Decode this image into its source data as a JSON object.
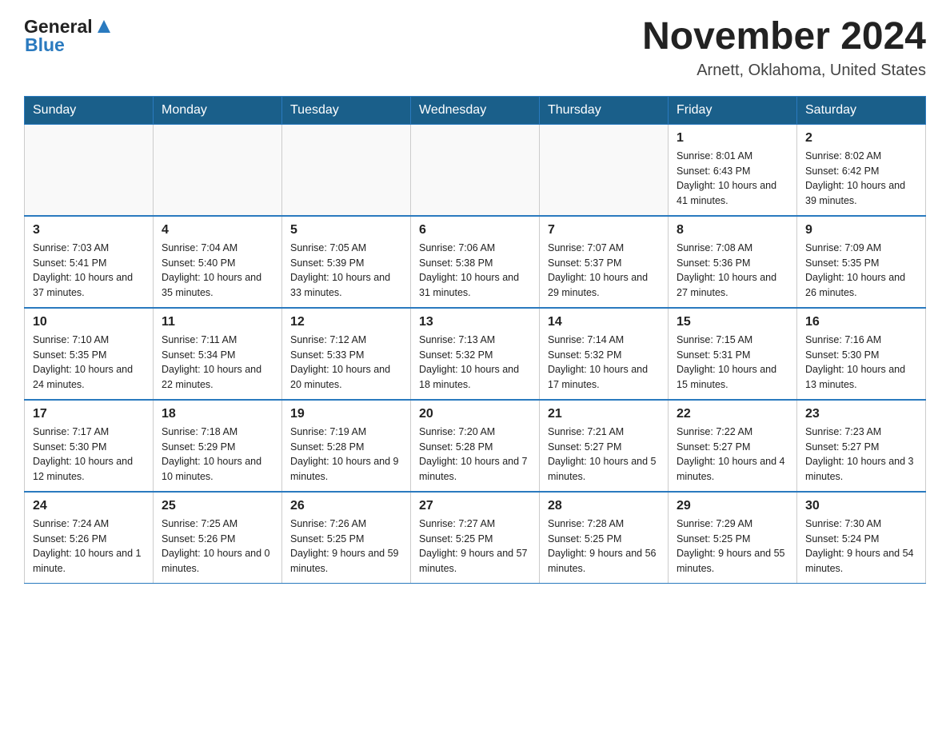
{
  "logo": {
    "general": "General",
    "blue": "Blue"
  },
  "title": {
    "month": "November 2024",
    "location": "Arnett, Oklahoma, United States"
  },
  "days_of_week": [
    "Sunday",
    "Monday",
    "Tuesday",
    "Wednesday",
    "Thursday",
    "Friday",
    "Saturday"
  ],
  "weeks": [
    [
      {
        "day": "",
        "info": ""
      },
      {
        "day": "",
        "info": ""
      },
      {
        "day": "",
        "info": ""
      },
      {
        "day": "",
        "info": ""
      },
      {
        "day": "",
        "info": ""
      },
      {
        "day": "1",
        "info": "Sunrise: 8:01 AM\nSunset: 6:43 PM\nDaylight: 10 hours and 41 minutes."
      },
      {
        "day": "2",
        "info": "Sunrise: 8:02 AM\nSunset: 6:42 PM\nDaylight: 10 hours and 39 minutes."
      }
    ],
    [
      {
        "day": "3",
        "info": "Sunrise: 7:03 AM\nSunset: 5:41 PM\nDaylight: 10 hours and 37 minutes."
      },
      {
        "day": "4",
        "info": "Sunrise: 7:04 AM\nSunset: 5:40 PM\nDaylight: 10 hours and 35 minutes."
      },
      {
        "day": "5",
        "info": "Sunrise: 7:05 AM\nSunset: 5:39 PM\nDaylight: 10 hours and 33 minutes."
      },
      {
        "day": "6",
        "info": "Sunrise: 7:06 AM\nSunset: 5:38 PM\nDaylight: 10 hours and 31 minutes."
      },
      {
        "day": "7",
        "info": "Sunrise: 7:07 AM\nSunset: 5:37 PM\nDaylight: 10 hours and 29 minutes."
      },
      {
        "day": "8",
        "info": "Sunrise: 7:08 AM\nSunset: 5:36 PM\nDaylight: 10 hours and 27 minutes."
      },
      {
        "day": "9",
        "info": "Sunrise: 7:09 AM\nSunset: 5:35 PM\nDaylight: 10 hours and 26 minutes."
      }
    ],
    [
      {
        "day": "10",
        "info": "Sunrise: 7:10 AM\nSunset: 5:35 PM\nDaylight: 10 hours and 24 minutes."
      },
      {
        "day": "11",
        "info": "Sunrise: 7:11 AM\nSunset: 5:34 PM\nDaylight: 10 hours and 22 minutes."
      },
      {
        "day": "12",
        "info": "Sunrise: 7:12 AM\nSunset: 5:33 PM\nDaylight: 10 hours and 20 minutes."
      },
      {
        "day": "13",
        "info": "Sunrise: 7:13 AM\nSunset: 5:32 PM\nDaylight: 10 hours and 18 minutes."
      },
      {
        "day": "14",
        "info": "Sunrise: 7:14 AM\nSunset: 5:32 PM\nDaylight: 10 hours and 17 minutes."
      },
      {
        "day": "15",
        "info": "Sunrise: 7:15 AM\nSunset: 5:31 PM\nDaylight: 10 hours and 15 minutes."
      },
      {
        "day": "16",
        "info": "Sunrise: 7:16 AM\nSunset: 5:30 PM\nDaylight: 10 hours and 13 minutes."
      }
    ],
    [
      {
        "day": "17",
        "info": "Sunrise: 7:17 AM\nSunset: 5:30 PM\nDaylight: 10 hours and 12 minutes."
      },
      {
        "day": "18",
        "info": "Sunrise: 7:18 AM\nSunset: 5:29 PM\nDaylight: 10 hours and 10 minutes."
      },
      {
        "day": "19",
        "info": "Sunrise: 7:19 AM\nSunset: 5:28 PM\nDaylight: 10 hours and 9 minutes."
      },
      {
        "day": "20",
        "info": "Sunrise: 7:20 AM\nSunset: 5:28 PM\nDaylight: 10 hours and 7 minutes."
      },
      {
        "day": "21",
        "info": "Sunrise: 7:21 AM\nSunset: 5:27 PM\nDaylight: 10 hours and 5 minutes."
      },
      {
        "day": "22",
        "info": "Sunrise: 7:22 AM\nSunset: 5:27 PM\nDaylight: 10 hours and 4 minutes."
      },
      {
        "day": "23",
        "info": "Sunrise: 7:23 AM\nSunset: 5:27 PM\nDaylight: 10 hours and 3 minutes."
      }
    ],
    [
      {
        "day": "24",
        "info": "Sunrise: 7:24 AM\nSunset: 5:26 PM\nDaylight: 10 hours and 1 minute."
      },
      {
        "day": "25",
        "info": "Sunrise: 7:25 AM\nSunset: 5:26 PM\nDaylight: 10 hours and 0 minutes."
      },
      {
        "day": "26",
        "info": "Sunrise: 7:26 AM\nSunset: 5:25 PM\nDaylight: 9 hours and 59 minutes."
      },
      {
        "day": "27",
        "info": "Sunrise: 7:27 AM\nSunset: 5:25 PM\nDaylight: 9 hours and 57 minutes."
      },
      {
        "day": "28",
        "info": "Sunrise: 7:28 AM\nSunset: 5:25 PM\nDaylight: 9 hours and 56 minutes."
      },
      {
        "day": "29",
        "info": "Sunrise: 7:29 AM\nSunset: 5:25 PM\nDaylight: 9 hours and 55 minutes."
      },
      {
        "day": "30",
        "info": "Sunrise: 7:30 AM\nSunset: 5:24 PM\nDaylight: 9 hours and 54 minutes."
      }
    ]
  ]
}
